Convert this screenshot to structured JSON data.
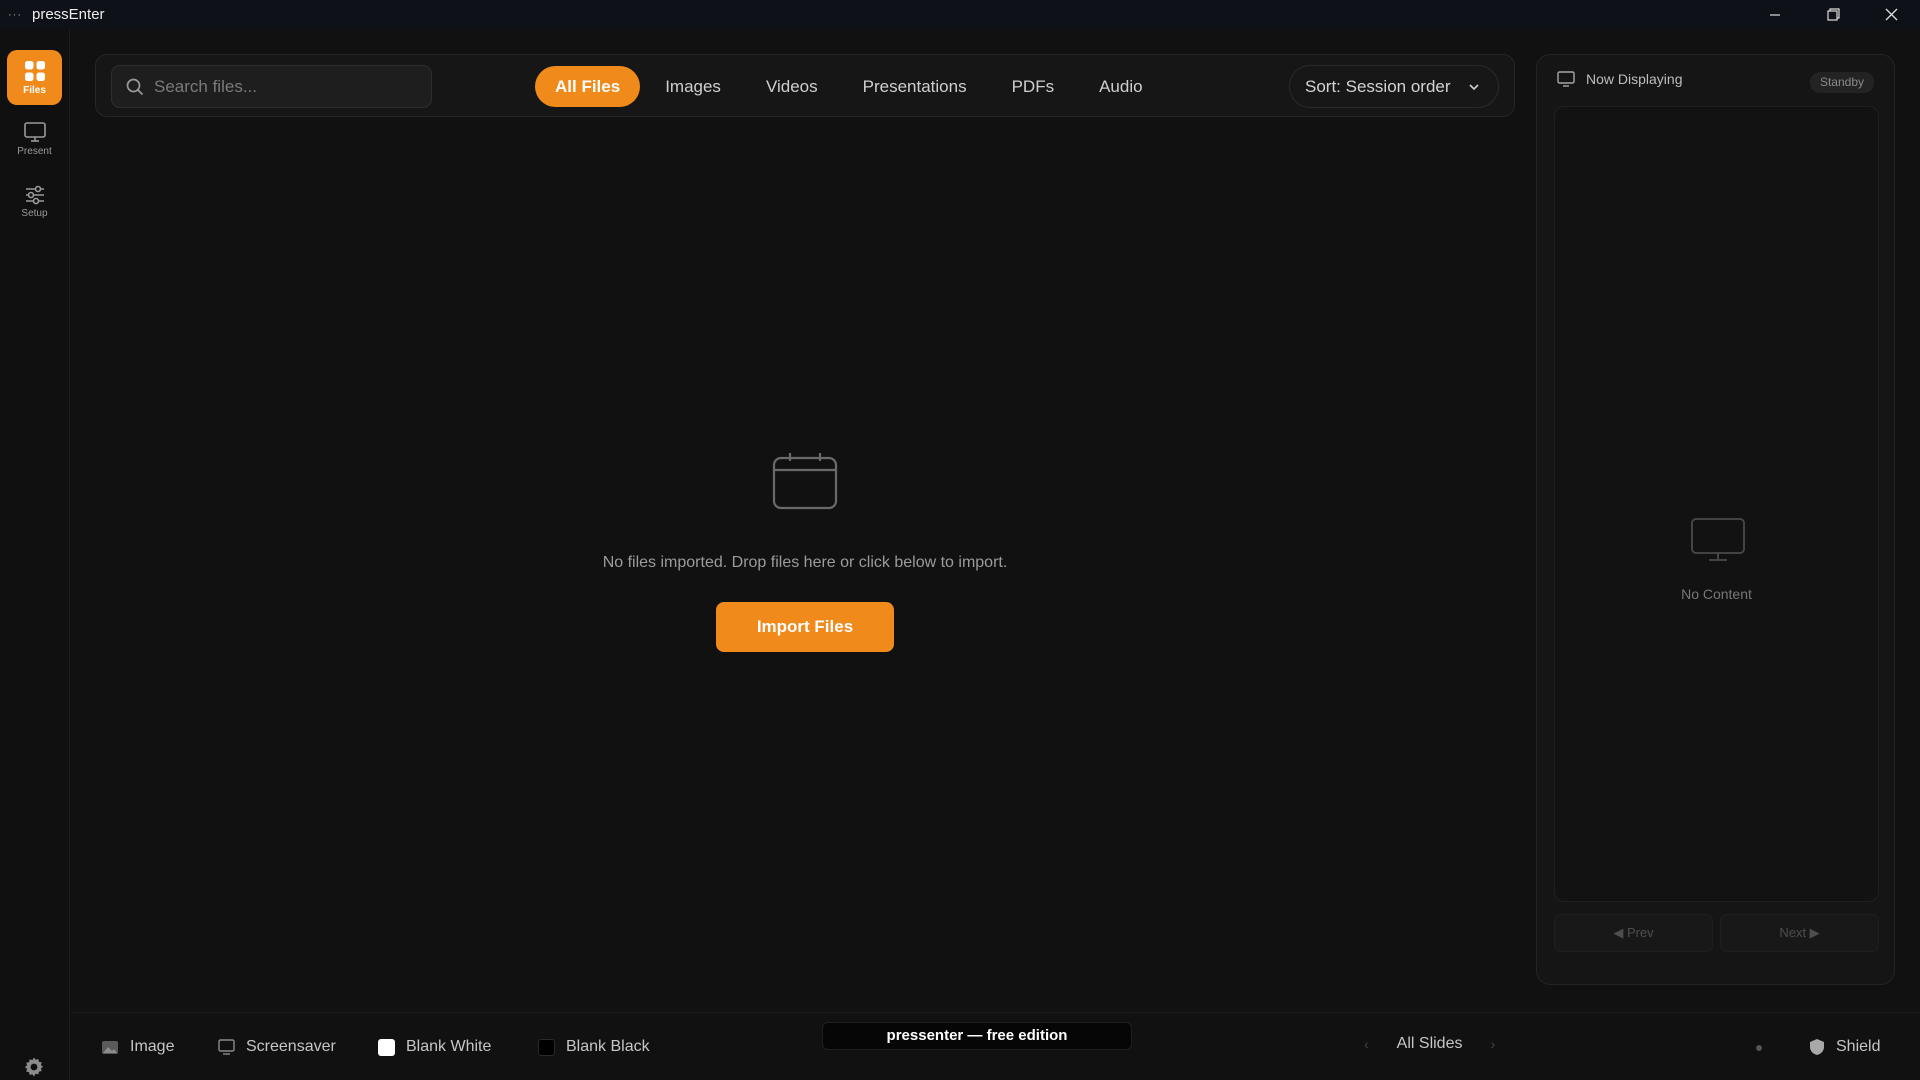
{
  "window": {
    "title": "pressEnter",
    "menu_dots": "···"
  },
  "rail": {
    "items": [
      {
        "label": "Files",
        "icon": "grid-icon",
        "active": true
      },
      {
        "label": "Present",
        "icon": "monitor-icon",
        "active": false
      },
      {
        "label": "Setup",
        "icon": "sliders-icon",
        "active": false
      }
    ],
    "settings_icon": "gear-icon"
  },
  "toolbar": {
    "search_placeholder": "Search files...",
    "search_value": "",
    "tabs": [
      "All Files",
      "Images",
      "Videos",
      "Presentations",
      "PDFs",
      "Audio"
    ],
    "active_tab": "All Files",
    "sort_label": "Sort: Session order"
  },
  "empty_state": {
    "message": "No files imported. Drop files here or click below to import.",
    "button_label": "Import Files"
  },
  "panel": {
    "title": "Now Displaying",
    "status": "Standby",
    "no_content": "No Content",
    "prev_label": "◀ Prev",
    "next_label": "Next ▶"
  },
  "bottom": {
    "image_label": "Image",
    "screensaver_label": "Screensaver",
    "blank_white_label": "Blank White",
    "blank_black_label": "Blank Black",
    "edition": "pressenter — free edition",
    "slides_label": "All Slides",
    "slides_prev": "‹",
    "slides_next": "›",
    "shield_label": "Shield"
  },
  "colors": {
    "accent": "#f08a1a",
    "background": "#111111",
    "titlebar": "#0e1117"
  }
}
